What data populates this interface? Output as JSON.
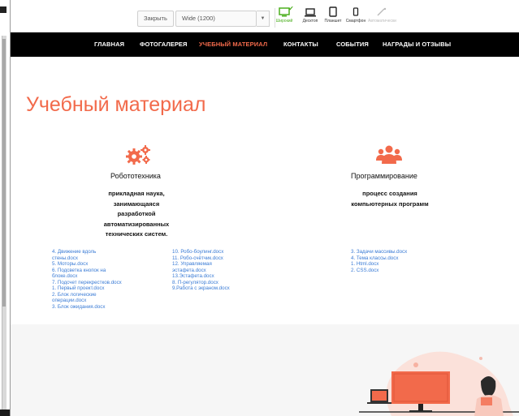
{
  "toolbar": {
    "close_label": "Закрыть",
    "viewport_select": "Wide (1200)",
    "devices": [
      {
        "label": "Широкий",
        "icon": "wide-screen-icon",
        "active": true
      },
      {
        "label": "Десктоп",
        "icon": "laptop-icon",
        "active": false
      },
      {
        "label": "Планшет",
        "icon": "tablet-icon",
        "active": false
      },
      {
        "label": "Смартфон",
        "icon": "smartphone-icon",
        "active": false
      },
      {
        "label": "Автоматически",
        "icon": "auto-scale-icon",
        "active": false
      }
    ],
    "auto_hint": "auto",
    "active_color": "#4caf1f"
  },
  "nav": {
    "items": [
      {
        "label": "ГЛАВНАЯ"
      },
      {
        "label": "ФОТОГАЛЕРЕЯ"
      },
      {
        "label": "УЧЕБНЫЙ МАТЕРИАЛ"
      },
      {
        "label": "КОНТАКТЫ"
      },
      {
        "label": "СОБЫТИЯ"
      },
      {
        "label": "НАГРАДЫ И ОТЗЫВЫ"
      }
    ],
    "active_color": "#f26a4b"
  },
  "page": {
    "title": "Учебный материал",
    "accent_color": "#f26a4b"
  },
  "robotics": {
    "title": "Робототехника",
    "desc_lines": [
      "прикладная наука,",
      "занимающаяся",
      "разработкой",
      "автоматизированных",
      "технических систем."
    ],
    "icon": "gears-icon",
    "files_col1": [
      "4. Движение вдоль",
      "стены.docx",
      "5. Моторы.docx",
      "6. Подсветка кнопок на",
      "блоке.docx",
      "7. Подсчет перекрестков.docx",
      "1. Первый проект.docx",
      "2. Блок логические",
      "операции.docx",
      "3. Блок ожидания.docx"
    ],
    "files_col2": [
      "10. Робо-боулинг.docx",
      "11. Робо-счётчик.docx",
      "12. Управляемая",
      "эстафета.docx",
      "13.Эстафета.docx",
      "8. П-регулятор.docx",
      "9.Работа с экраном.docx"
    ]
  },
  "programming": {
    "title": "Программирование",
    "desc_lines": [
      "процесс создания",
      "компьютерных программ"
    ],
    "icon": "people-group-icon",
    "files": [
      "3. Задачи массивы.docx",
      "4. Тема классы.docx",
      "1. Html.docx",
      "2. CSS.docx"
    ]
  }
}
